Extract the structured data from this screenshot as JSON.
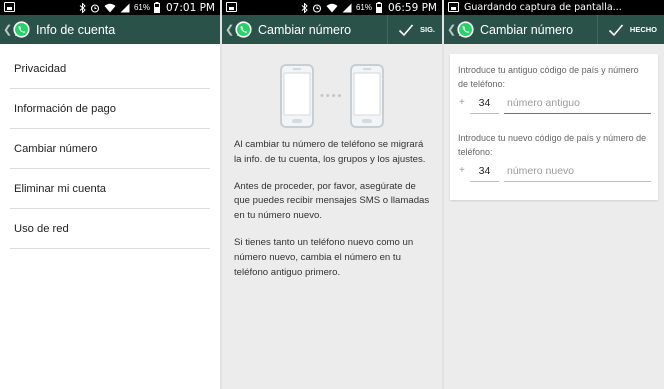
{
  "screen1": {
    "status": {
      "battery_pct": "61%",
      "time": "07:01 PM"
    },
    "title": "Info de cuenta",
    "menu": [
      {
        "label": "Privacidad"
      },
      {
        "label": "Información de pago"
      },
      {
        "label": "Cambiar número"
      },
      {
        "label": "Eliminar mi cuenta"
      },
      {
        "label": "Uso de red"
      }
    ]
  },
  "screen2": {
    "status": {
      "battery_pct": "61%",
      "time": "06:59 PM"
    },
    "title": "Cambiar número",
    "action_label": "SIG.",
    "paragraphs": [
      "Al cambiar tu número de teléfono se migrará la info. de tu cuenta, los grupos y los ajustes.",
      "Antes de proceder, por favor, asegúrate de que puedes recibir mensajes SMS o llamadas en tu número nuevo.",
      "Si tienes tanto un teléfono nuevo como un número nuevo, cambia el número en tu teléfono antiguo primero."
    ]
  },
  "screen3": {
    "status": {
      "notification": "Guardando captura de pantalla..."
    },
    "title": "Cambiar número",
    "action_label": "HECHO",
    "old": {
      "label": "Introduce tu antiguo código de país y número de teléfono:",
      "plus": "+",
      "country_code": "34",
      "placeholder": "número antiguo"
    },
    "new": {
      "label": "Introduce tu nuevo código de país y número de teléfono:",
      "plus": "+",
      "country_code": "34",
      "placeholder": "número nuevo"
    }
  },
  "icons": [
    "back-icon",
    "whatsapp-logo-icon",
    "checkmark-icon",
    "phone-icon",
    "bluetooth-icon",
    "alarm-icon",
    "wifi-icon",
    "signal-icon",
    "battery-icon",
    "screenshot-icon"
  ],
  "colors": {
    "action_bar": "#2b5249",
    "accent": "#3d8c80",
    "whatsapp_green": "#25d366"
  }
}
